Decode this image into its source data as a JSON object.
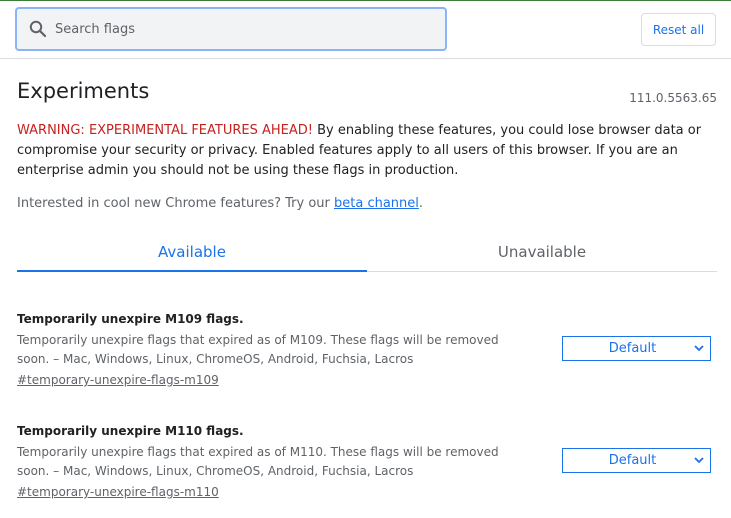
{
  "header": {
    "search": {
      "placeholder": "Search flags",
      "value": ""
    },
    "reset_label": "Reset all"
  },
  "page": {
    "title": "Experiments",
    "version": "111.0.5563.65",
    "warning_lead": "WARNING: EXPERIMENTAL FEATURES AHEAD!",
    "warning_body": " By enabling these features, you could lose browser data or compromise your security or privacy. Enabled features apply to all users of this browser. If you are an enterprise admin you should not be using these flags in production.",
    "interest_text": "Interested in cool new Chrome features? Try our ",
    "interest_link": "beta channel",
    "interest_end": "."
  },
  "tabs": [
    {
      "label": "Available",
      "active": true
    },
    {
      "label": "Unavailable",
      "active": false
    }
  ],
  "flags": [
    {
      "title": "Temporarily unexpire M109 flags.",
      "description": "Temporarily unexpire flags that expired as of M109. These flags will be removed soon. – Mac, Windows, Linux, ChromeOS, Android, Fuchsia, Lacros",
      "link": "#temporary-unexpire-flags-m109",
      "selected": "Default"
    },
    {
      "title": "Temporarily unexpire M110 flags.",
      "description": "Temporarily unexpire flags that expired as of M110. These flags will be removed soon. – Mac, Windows, Linux, ChromeOS, Android, Fuchsia, Lacros",
      "link": "#temporary-unexpire-flags-m110",
      "selected": "Default"
    }
  ],
  "colors": {
    "accent": "#1a73e8",
    "warning": "#c5221f",
    "search_focus": "#8ab4f8",
    "divider": "#dadce0"
  },
  "icons": {
    "search": "search-icon",
    "dropdown": "chevron-down-icon"
  }
}
